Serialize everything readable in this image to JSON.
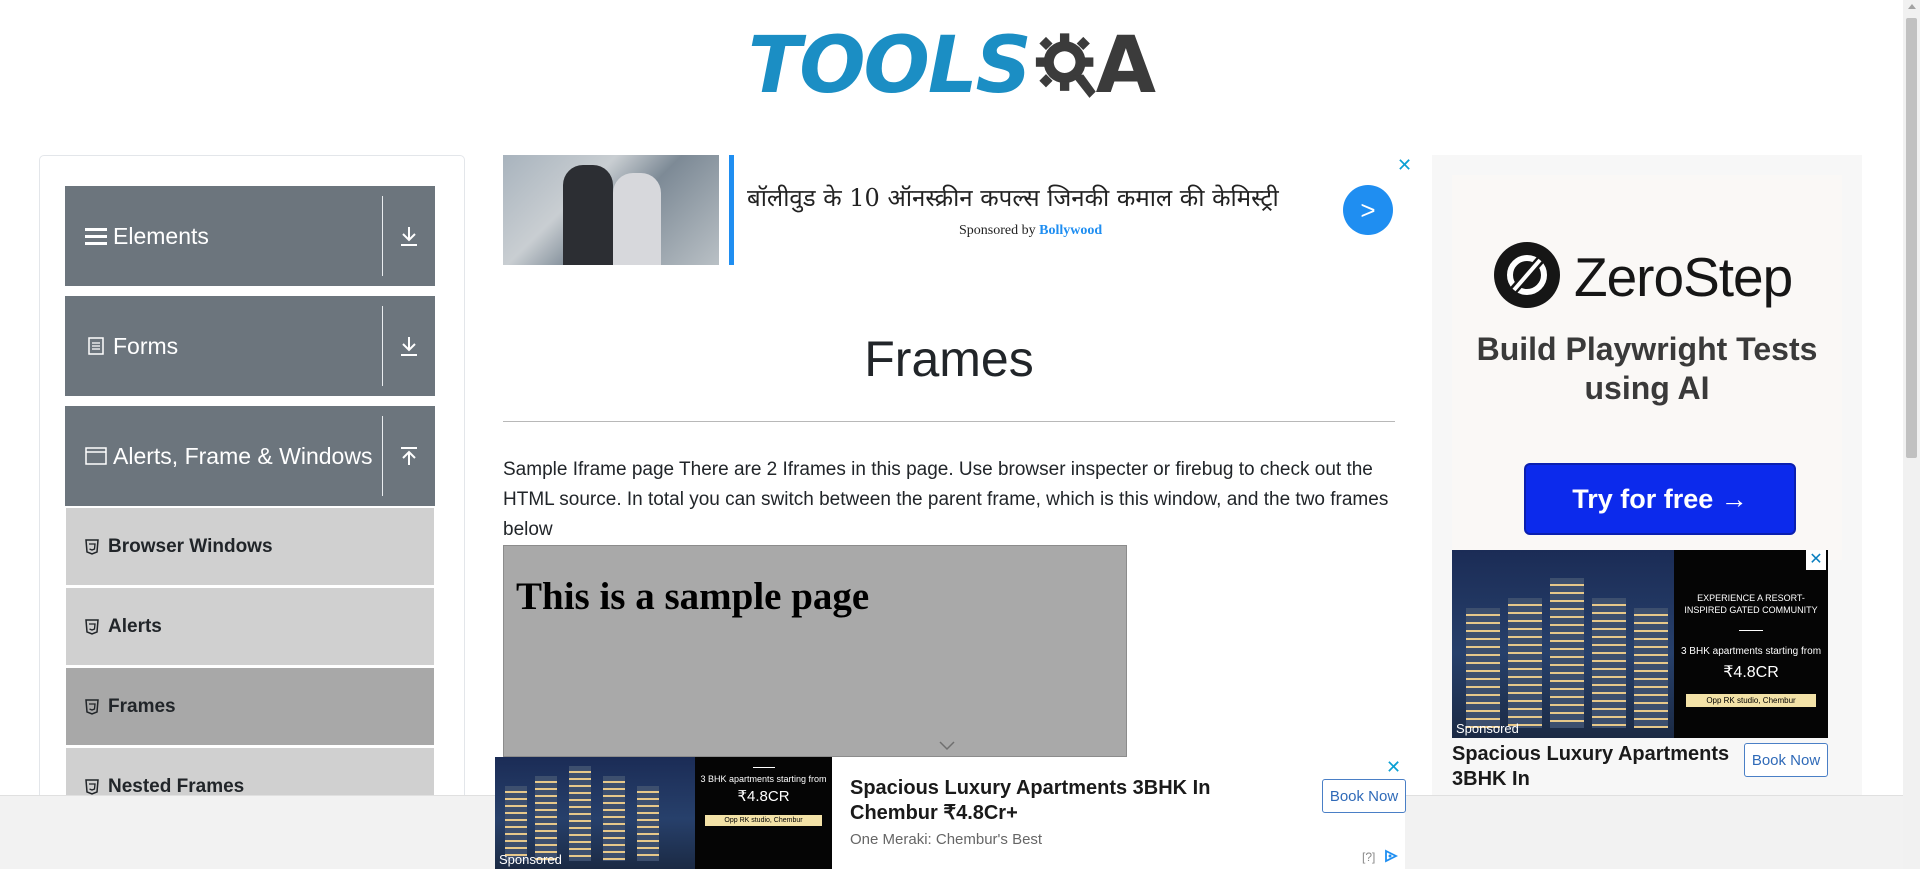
{
  "header": {
    "logo_tools": "TOOLS",
    "logo_a": "A"
  },
  "sidebar": {
    "groups": [
      {
        "label": "Elements",
        "icon": "hamburger-icon",
        "toggle": "download-icon"
      },
      {
        "label": "Forms",
        "icon": "document-icon",
        "toggle": "download-icon"
      },
      {
        "label": "Alerts, Frame & Windows",
        "icon": "window-icon",
        "toggle": "upload-icon"
      }
    ],
    "items": [
      {
        "label": "Browser Windows"
      },
      {
        "label": "Alerts"
      },
      {
        "label": "Frames"
      },
      {
        "label": "Nested Frames"
      }
    ]
  },
  "top_ad": {
    "title": "बॉलीवुड के 10 ऑनस्क्रीन कपल्स जिनकी कमाल की केमिस्ट्री",
    "sponsored_by": "Sponsored by",
    "sponsor": "Bollywood",
    "go": ">",
    "close": "✕"
  },
  "main": {
    "title": "Frames",
    "description": "Sample Iframe page There are 2 Iframes in this page. Use browser inspecter or firebug to check out the HTML source. In total you can switch between the parent frame, which is this window, and the two frames below",
    "iframe_heading": "This is a sample page"
  },
  "right_ad": {
    "brand": "ZeroStep",
    "tagline": "Build Playwright Tests using AI",
    "button": "Try for free →",
    "promo_line1": "EXPERIENCE A RESORT-INSPIRED GATED COMMUNITY",
    "promo_line2": "3 BHK apartments starting from",
    "promo_price": "₹4.8CR",
    "promo_location": "Opp RK studio, Chembur",
    "sponsored": "Sponsored",
    "title": "Spacious Luxury Apartments 3BHK In",
    "book": "Book Now",
    "close": "✕"
  },
  "bottom_ad": {
    "promo_line2": "3 BHK apartments starting from",
    "promo_price": "₹4.8CR",
    "promo_location": "Opp RK studio, Chembur",
    "sponsored": "Sponsored",
    "title": "Spacious Luxury Apartments 3BHK In Chembur ₹4.8Cr+",
    "subtitle": "One Meraki: Chembur's Best",
    "book": "Book Now",
    "info": "[?]",
    "close": "✕"
  },
  "colors": {
    "brand_blue": "#1b8ec4",
    "sidebar_group": "#6c757d",
    "sidebar_item": "#d0d0d0",
    "sidebar_item_active": "#a8a8a8",
    "cta_blue": "#0c2aec"
  }
}
